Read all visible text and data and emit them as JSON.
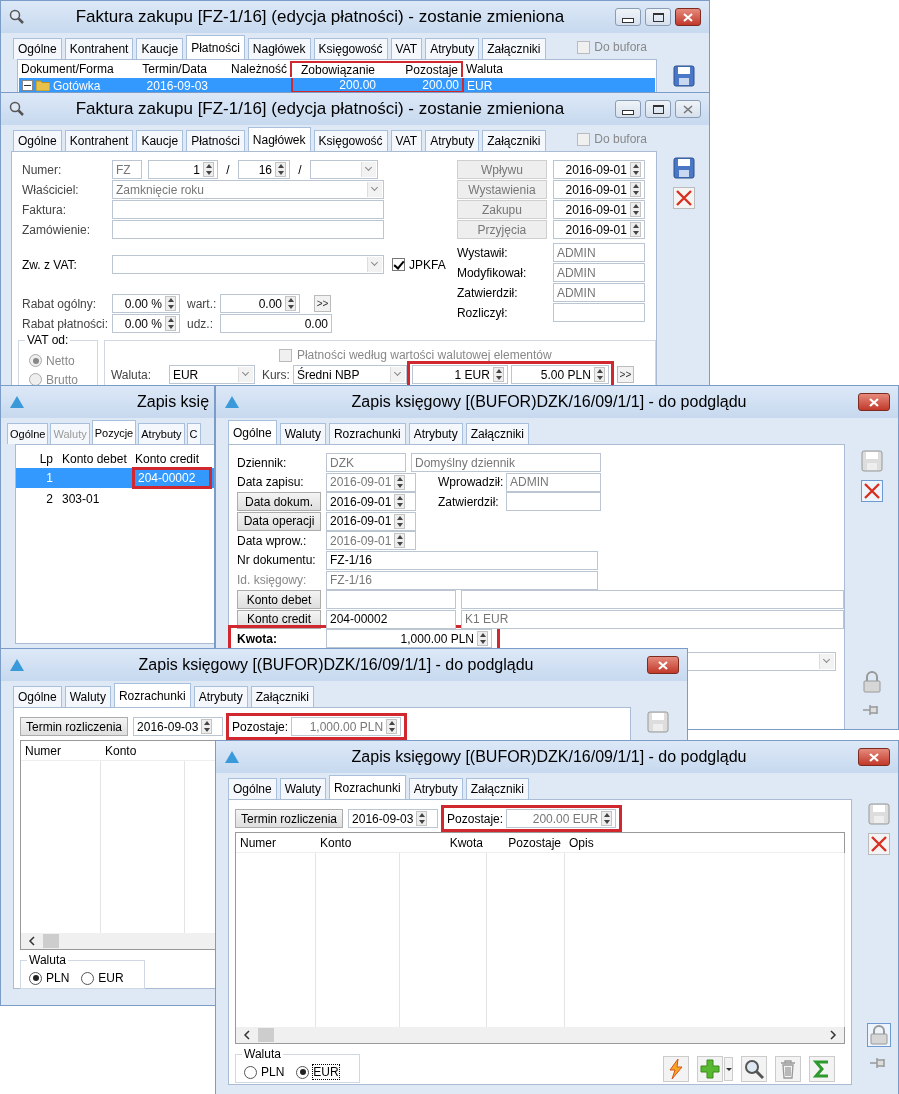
{
  "invoice_payments_window": {
    "title": "Faktura zakupu [FZ-1/16] (edycja płatności) - zostanie zmieniona",
    "tabs": [
      {
        "label": "Ogólne",
        "selected": false
      },
      {
        "label": "Kontrahent",
        "selected": false
      },
      {
        "label": "Kaucje",
        "selected": false
      },
      {
        "label": "Płatności",
        "selected": true
      },
      {
        "label": "Nagłówek",
        "selected": false
      },
      {
        "label": "Księgowość",
        "selected": false
      },
      {
        "label": "VAT",
        "selected": false
      },
      {
        "label": "Atrybuty",
        "selected": false
      },
      {
        "label": "Załączniki",
        "selected": false
      }
    ],
    "do_bufora": {
      "label": "Do bufora",
      "checked": false
    },
    "columns": [
      {
        "label": "Dokument/Forma",
        "highlighted": false
      },
      {
        "label": "Termin/Data",
        "highlighted": false
      },
      {
        "label": "Należność",
        "highlighted": false
      },
      {
        "label": "Zobowiązanie",
        "highlighted": true
      },
      {
        "label": "Pozostaje",
        "highlighted": true
      },
      {
        "label": "Waluta",
        "highlighted": false
      }
    ],
    "rows": [
      {
        "form": "Gotówka",
        "date": "2016-09-03",
        "zobowiazanie": "200.00",
        "pozostaje": "200.00",
        "waluta": "EUR",
        "selected": true,
        "expanded": true
      }
    ]
  },
  "invoice_header_window": {
    "title": "Faktura zakupu [FZ-1/16] (edycja płatności) - zostanie zmieniona",
    "tabs": [
      {
        "label": "Ogólne",
        "selected": false
      },
      {
        "label": "Kontrahent",
        "selected": false
      },
      {
        "label": "Kaucje",
        "selected": false
      },
      {
        "label": "Płatności",
        "selected": false
      },
      {
        "label": "Nagłówek",
        "selected": true
      },
      {
        "label": "Księgowość",
        "selected": false
      },
      {
        "label": "VAT",
        "selected": false
      },
      {
        "label": "Atrybuty",
        "selected": false
      },
      {
        "label": "Załączniki",
        "selected": false
      }
    ],
    "do_bufora": {
      "label": "Do bufora",
      "checked": false
    },
    "numer": {
      "label": "Numer:",
      "series": "FZ",
      "number": "1",
      "separator_1": "/",
      "year": "16",
      "separator_2": "/"
    },
    "wlasciciel": {
      "label": "Właściciel:",
      "value": "Zamknięcie roku"
    },
    "faktura": {
      "label": "Faktura:"
    },
    "zamowienie": {
      "label": "Zamówienie:"
    },
    "zw_z_vat": {
      "label": "Zw. z VAT:"
    },
    "jpkfa": {
      "label": "JPKFA",
      "checked": true
    },
    "rabat_ogolny": {
      "label": "Rabat ogólny:",
      "percent": "0.00 %",
      "sub_label": "wart.:",
      "value": "0.00",
      "more": ">>"
    },
    "rabat_platnosci": {
      "label": "Rabat płatności:",
      "percent": "0.00 %",
      "sub_label": "udz.:",
      "value": "0.00"
    },
    "vat_od": {
      "label": "VAT od:",
      "options": [
        {
          "label": "Netto",
          "selected": true
        },
        {
          "label": "Brutto",
          "selected": false
        }
      ]
    },
    "platnosci_walutowe": {
      "label": "Płatności według wartości walutowej elementów",
      "checked": false
    },
    "waluta": {
      "label": "Waluta:",
      "value": "EUR"
    },
    "kurs": {
      "label": "Kurs:",
      "value": "Średni NBP",
      "units": "1 EUR",
      "rate": "5.00 PLN",
      "highlighted": true,
      "more": ">>"
    },
    "dates": [
      {
        "label": "Wpływu",
        "value": "2016-09-01"
      },
      {
        "label": "Wystawienia",
        "value": "2016-09-01"
      },
      {
        "label": "Zakupu",
        "value": "2016-09-01"
      },
      {
        "label": "Przyjęcia",
        "value": "2016-09-01"
      }
    ],
    "people": [
      {
        "label": "Wystawił:",
        "value": "ADMIN"
      },
      {
        "label": "Modyfikował:",
        "value": "ADMIN"
      },
      {
        "label": "Zatwierdził:",
        "value": "ADMIN"
      },
      {
        "label": "Rozliczył:"
      }
    ]
  },
  "entry_positions_window": {
    "title": "Zapis księ",
    "tabs": [
      {
        "label": "Ogólne",
        "selected": false,
        "disabled": false
      },
      {
        "label": "Waluty",
        "selected": false,
        "disabled": true
      },
      {
        "label": "Pozycje",
        "selected": true,
        "disabled": false
      },
      {
        "label": "Atrybuty",
        "selected": false,
        "disabled": false
      },
      {
        "label": "C",
        "selected": false,
        "disabled": false
      }
    ],
    "columns": [
      "Lp",
      "Konto debet",
      "Konto credit"
    ],
    "rows": [
      {
        "lp": "1",
        "credit": "204-00002",
        "selected": true,
        "credit_highlighted": true
      },
      {
        "lp": "2",
        "debet": "303-01",
        "selected": false,
        "credit_highlighted": false
      }
    ]
  },
  "entry_general_window": {
    "title": "Zapis księgowy [(BUFOR)DZK/16/09/1/1] - do podglądu",
    "tabs": [
      {
        "label": "Ogólne",
        "selected": true
      },
      {
        "label": "Waluty",
        "selected": false
      },
      {
        "label": "Rozrachunki",
        "selected": false
      },
      {
        "label": "Atrybuty",
        "selected": false
      },
      {
        "label": "Załączniki",
        "selected": false
      }
    ],
    "dziennik": {
      "label": "Dziennik:",
      "code": "DZK",
      "name": "Domyślny dziennik"
    },
    "data_zapisu": {
      "label": "Data zapisu:",
      "value": "2016-09-01"
    },
    "wprowadzil": {
      "label": "Wprowadził:",
      "value": "ADMIN"
    },
    "data_dokum": {
      "button": "Data dokum.",
      "value": "2016-09-01"
    },
    "zatwierdzil": {
      "label": "Zatwierdził:"
    },
    "data_operacji": {
      "button": "Data operacji",
      "value": "2016-09-01"
    },
    "data_wprow": {
      "label": "Data wprow.:",
      "value": "2016-09-01"
    },
    "nr_dokumentu": {
      "label": "Nr dokumentu:",
      "value": "FZ-1/16"
    },
    "id_ksiegowy": {
      "label": "Id. księgowy:",
      "value": "FZ-1/16"
    },
    "konto_debet": {
      "button": "Konto debet"
    },
    "konto_credit": {
      "button": "Konto credit",
      "value": "204-00002",
      "name": "K1 EUR"
    },
    "kwota": {
      "label": "Kwota:",
      "value": "1,000.00 PLN",
      "highlighted": true
    }
  },
  "settlements_windows": [
    {
      "title": "Zapis księgowy [(BUFOR)DZK/16/09/1/1] - do podglądu",
      "tabs": [
        {
          "label": "Ogólne",
          "selected": false
        },
        {
          "label": "Waluty",
          "selected": false
        },
        {
          "label": "Rozrachunki",
          "selected": true
        },
        {
          "label": "Atrybuty",
          "selected": false
        },
        {
          "label": "Załączniki",
          "selected": false
        }
      ],
      "termin": {
        "button": "Termin rozliczenia",
        "value": "2016-09-03"
      },
      "pozostaje": {
        "label": "Pozostaje:",
        "value": "1,000.00 PLN",
        "highlighted": true
      },
      "columns": [
        "Numer",
        "Konto"
      ],
      "waluta": {
        "label": "Waluta",
        "options": [
          {
            "label": "PLN",
            "selected": true
          },
          {
            "label": "EUR",
            "selected": false
          }
        ]
      }
    },
    {
      "title": "Zapis księgowy [(BUFOR)DZK/16/09/1/1] - do podglądu",
      "tabs": [
        {
          "label": "Ogólne",
          "selected": false
        },
        {
          "label": "Waluty",
          "selected": false
        },
        {
          "label": "Rozrachunki",
          "selected": true
        },
        {
          "label": "Atrybuty",
          "selected": false
        },
        {
          "label": "Załączniki",
          "selected": false
        }
      ],
      "termin": {
        "button": "Termin rozliczenia",
        "value": "2016-09-03"
      },
      "pozostaje": {
        "label": "Pozostaje:",
        "value": "200.00 EUR",
        "highlighted": true
      },
      "columns": [
        "Numer",
        "Konto",
        "Kwota",
        "Pozostaje",
        "Opis"
      ],
      "waluta": {
        "label": "Waluta",
        "options": [
          {
            "label": "PLN",
            "selected": false
          },
          {
            "label": "EUR",
            "selected": true
          }
        ]
      }
    }
  ]
}
